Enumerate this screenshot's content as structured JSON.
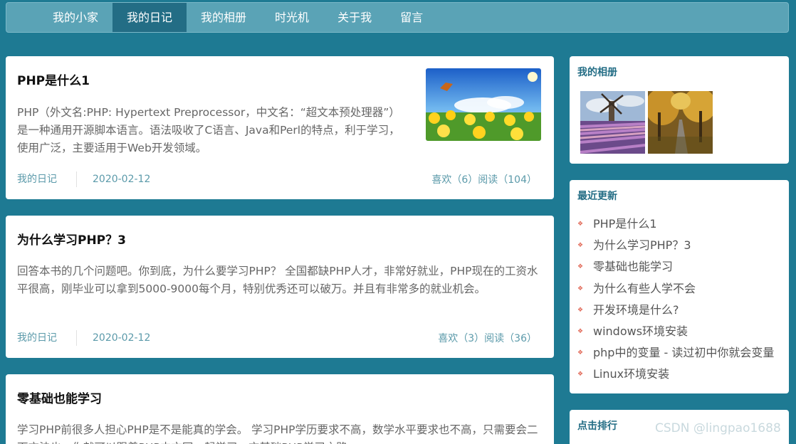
{
  "nav": {
    "items": [
      "我的小家",
      "我的日记",
      "我的相册",
      "时光机",
      "关于我",
      "留言"
    ],
    "active_index": 1
  },
  "articles": [
    {
      "title": "PHP是什么1",
      "summary": "PHP（外文名:PHP: Hypertext Preprocessor，中文名：“超文本预处理器”）是一种通用开源脚本语言。语法吸收了C语言、Java和Perl的特点，利于学习，使用广泛，主要适用于Web开发领域。",
      "category": "我的日记",
      "date": "2020-02-12",
      "stats": "喜欢（6）阅读（104）"
    },
    {
      "title": "为什么学习PHP？3",
      "summary": "回答本书的几个问题吧。你到底，为什么要学习PHP？ 全国都缺PHP人才，非常好就业，PHP现在的工资水平很高，刚毕业可以拿到5000-9000每个月，特别优秀还可以破万。并且有非常多的就业机会。",
      "category": "我的日记",
      "date": "2020-02-12",
      "stats": "喜欢（3）阅读（36）"
    },
    {
      "title": "零基础也能学习",
      "summary": "学习PHP前很多人担心PHP是不是能真的学会。 学习PHP学历要求不高，数学水平要求也不高，只需要会二面方法也，你就可以跟着PHP中文网一起学习，方基础PHP学习之路。",
      "category": "",
      "date": "",
      "stats": ""
    }
  ],
  "sidebar": {
    "album_title": "我的相册",
    "recent_title": "最近更新",
    "recent_items": [
      "PHP是什么1",
      "为什么学习PHP？3",
      "零基础也能学习",
      "为什么有些人学不会",
      "开发环境是什么?",
      "windows环境安装",
      "php中的变量 - 读过初中你就会变量",
      "Linux环境安装"
    ],
    "ranking_title": "点击排行"
  },
  "watermark": "CSDN @lingpao1688",
  "colors": {
    "background": "#1e7a93",
    "nav": "#5aa3b6",
    "nav_active": "#236d85",
    "accent_text": "#236d85",
    "meta_text": "#5b9aaa",
    "bullet": "#e26b5a"
  }
}
